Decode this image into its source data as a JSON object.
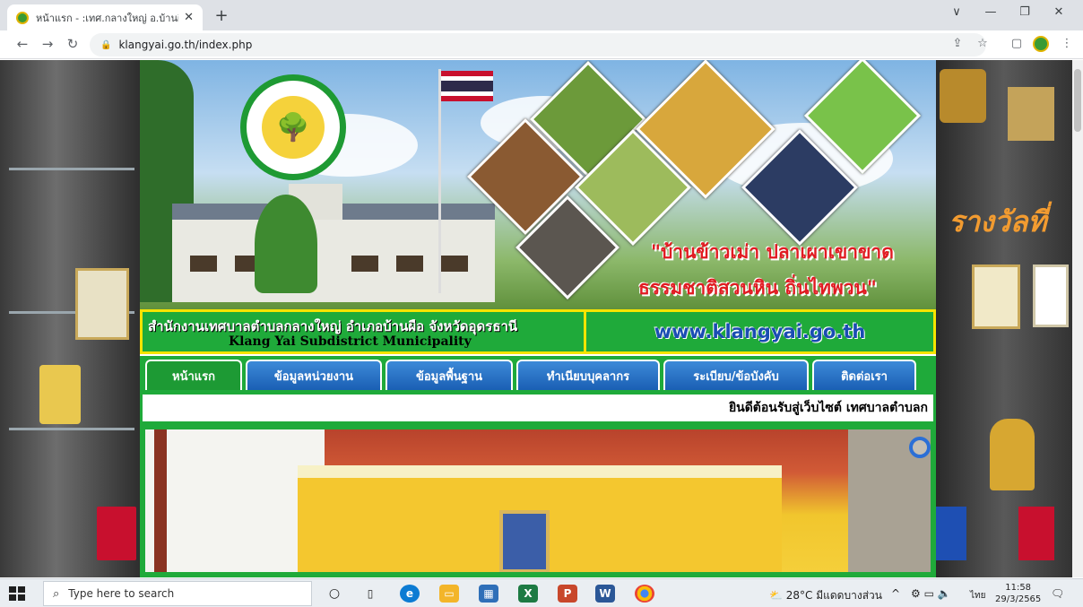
{
  "browser": {
    "tab_title": "หน้าแรก - :เทศ.กลางใหญ่ อ.บ้านผือ จ.อ",
    "tab_close": "✕",
    "new_tab": "+",
    "url": "klangyai.go.th/index.php",
    "window_controls": {
      "minimize_glyph": "∨",
      "dash": "—",
      "restore": "❐",
      "close": "✕"
    }
  },
  "site": {
    "slogan_line1": "\"บ้านข้าวเม่า ปลาเผาเขาขาด",
    "slogan_line2": "ธรรมชาติสวนหิน ถิ่นไทพวน\"",
    "org_name_th": "สำนักงานเทศบาลตำบลกลางใหญ่ อำเภอบ้านผือ จังหวัดอุดรธานี",
    "org_name_en": "Klang Yai Subdistrict Municipality",
    "website": "www.klangyai.go.th",
    "menu": [
      {
        "label": "หน้าแรก"
      },
      {
        "label": "ข้อมูลหน่วยงาน"
      },
      {
        "label": "ข้อมูลพื้นฐาน"
      },
      {
        "label": "ทำเนียบบุคลากร"
      },
      {
        "label": "ระเบียบ/ข้อบังคับ"
      },
      {
        "label": "ติดต่อเรา"
      }
    ],
    "marquee": "ยินดีต้อนรับสู่เว็บไซต์ เทศบาลตำบลก",
    "seal_glyph": "🌳",
    "side_text": "รางวัลที่"
  },
  "taskbar": {
    "search_placeholder": "Type here to search",
    "weather": "28°C มีแดดบางส่วน",
    "lang": "ไทย",
    "time": "11:58",
    "date": "29/3/2565"
  },
  "colors": {
    "green": "#1faa3a",
    "yellow": "#f6e400",
    "blue_tab": "#1a5fb4",
    "slogan_red": "#e11b22"
  }
}
